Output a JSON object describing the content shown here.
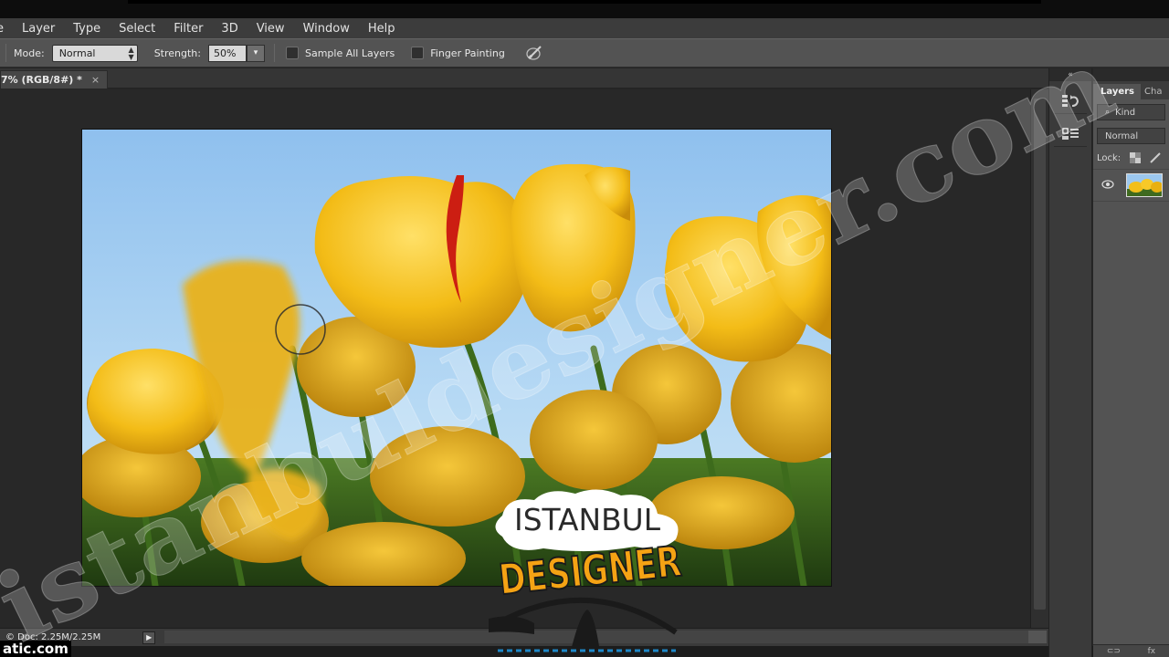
{
  "menubar": {
    "items": [
      "e",
      "Layer",
      "Type",
      "Select",
      "Filter",
      "3D",
      "View",
      "Window",
      "Help"
    ]
  },
  "options": {
    "mode_label": "Mode:",
    "mode_value": "Normal",
    "strength_label": "Strength:",
    "strength_value": "50%",
    "sample_all_layers": "Sample All Layers",
    "finger_painting": "Finger Painting",
    "sample_all_layers_checked": false,
    "finger_painting_checked": false,
    "brush_icon": "smudge-brush-icon"
  },
  "document": {
    "tab_title": "7% (RGB/8#) *",
    "close_glyph": "×"
  },
  "status": {
    "doc_info": "© Doc: 2.25M/2.25M",
    "play_glyph": "▶"
  },
  "layers_panel": {
    "tab_layers": "Layers",
    "tab_channels": "Cha",
    "filter_label": "Kind",
    "blend_mode": "Normal",
    "lock_label": "Lock:"
  },
  "watermarks": {
    "diagonal": "istanbuldesigner.com",
    "corner": "atic.com",
    "logo_line1": "ISTANBUL",
    "logo_line2": "DESIGNER"
  },
  "colors": {
    "sky_top": "#9cc8ef",
    "tulip": "#f2bf1b",
    "stem": "#3f6a1f",
    "logo_orange": "#f5a314"
  }
}
